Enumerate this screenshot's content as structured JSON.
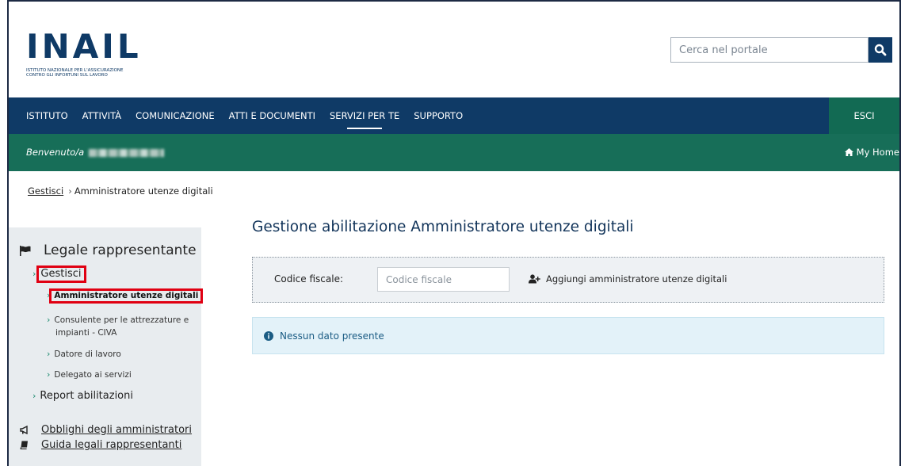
{
  "header": {
    "logo_word": "INAIL",
    "logo_sub_line1": "ISTITUTO NAZIONALE PER L'ASSICURAZIONE",
    "logo_sub_line2": "CONTRO GLI INFORTUNI SUL LAVORO",
    "search_placeholder": "Cerca nel portale",
    "search_icon": "search-icon"
  },
  "nav": {
    "items": [
      {
        "label": "ISTITUTO",
        "active": false
      },
      {
        "label": "ATTIVITÀ",
        "active": false
      },
      {
        "label": "COMUNICAZIONE",
        "active": false
      },
      {
        "label": "ATTI E DOCUMENTI",
        "active": false
      },
      {
        "label": "SERVIZI PER TE",
        "active": true
      },
      {
        "label": "SUPPORTO",
        "active": false
      }
    ],
    "exit_label": "ESCI"
  },
  "welcome": {
    "greeting": "Benvenuto/a",
    "home_label": "My Home"
  },
  "breadcrumb": {
    "parent": "Gestisci",
    "current": "Amministratore utenze digitali"
  },
  "sidebar": {
    "title": "Legale rappresentante",
    "gestisci": "Gestisci",
    "sub_items": [
      "Amministratore utenze digitali",
      "Consulente per le attrezzature e",
      "impianti - CIVA",
      "Datore di lavoro",
      "Delegato ai servizi"
    ],
    "report": "Report abilitazioni",
    "links": [
      "Obblighi degli amministratori",
      "Guida legali rappresentanti"
    ]
  },
  "main": {
    "title": "Gestione abilitazione Amministratore utenze digitali",
    "codice_label": "Codice fiscale:",
    "codice_placeholder": "Codice fiscale",
    "add_label": "Aggiungi amministratore utenze digitali",
    "info_text": "Nessun dato presente"
  },
  "colors": {
    "nav_blue": "#0f3a66",
    "green": "#176e58",
    "highlight_red": "#e00012"
  }
}
